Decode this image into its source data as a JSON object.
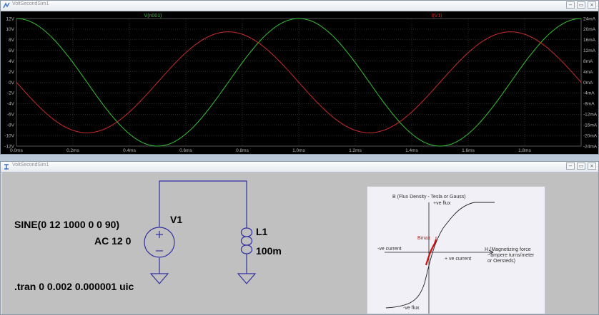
{
  "plot_window": {
    "title": "VoltSecondSim1",
    "trace_voltage_label": "V(n001)",
    "trace_current_label": "I(V1)",
    "trace_voltage_color": "#34c434",
    "trace_current_color": "#c82c2c",
    "left_axis_ticks": [
      "12V",
      "10V",
      "8V",
      "6V",
      "4V",
      "2V",
      "0V",
      "-2V",
      "-4V",
      "-6V",
      "-8V",
      "-10V",
      "-12V"
    ],
    "right_axis_ticks": [
      "24mA",
      "20mA",
      "16mA",
      "12mA",
      "8mA",
      "4mA",
      "0mA",
      "-4mA",
      "-8mA",
      "-12mA",
      "-16mA",
      "-20mA",
      "-24mA"
    ],
    "x_axis_ticks": [
      "0.0ms",
      "0.2ms",
      "0.4ms",
      "0.6ms",
      "0.8ms",
      "1.0ms",
      "1.2ms",
      "1.4ms",
      "1.6ms",
      "1.8ms"
    ]
  },
  "chart_data": {
    "type": "line",
    "x_unit": "ms",
    "xlim": [
      0,
      2.0
    ],
    "ylim_left": [
      -12,
      12
    ],
    "ylim_right": [
      -24,
      24
    ],
    "series": [
      {
        "name": "V(n001)",
        "axis": "left",
        "x": [
          0,
          0.25,
          0.5,
          0.75,
          1.0,
          1.25,
          1.5,
          1.75,
          2.0
        ],
        "values": [
          12,
          0,
          -12,
          0,
          12,
          0,
          -12,
          0,
          12
        ]
      },
      {
        "name": "I(V1)",
        "axis": "right",
        "x": [
          0,
          0.25,
          0.5,
          0.75,
          1.0,
          1.25,
          1.5,
          1.75,
          2.0
        ],
        "values": [
          0,
          -19,
          0,
          19,
          0,
          -19,
          0,
          19,
          0
        ]
      }
    ]
  },
  "schematic_window": {
    "title": "VoltSecondSim1",
    "source_function": "SINE(0 12 1000 0 0 90)",
    "source_name": "V1",
    "source_ac": "AC 12 0",
    "inductor_name": "L1",
    "inductor_value": "100m",
    "directive": ".tran 0 0.002 0.000001 uic",
    "wire_color": "#3030a0"
  },
  "bh_curve": {
    "y_axis_label": "B (Flux Density - Tesla or Gauss)",
    "pos_flux": "+ve flux",
    "neg_flux": "-ve flux",
    "x_axis_label_1": "H (Magnetizing force",
    "x_axis_label_2": "- ampere turns/meter",
    "x_axis_label_3": "or Oersteds)",
    "neg_current": "-ve current",
    "pos_current": "+ ve current",
    "bmax_label": "Bmax",
    "highlight_color": "#cc1111"
  },
  "window_buttons": {
    "minimize": "−",
    "restore": "▭",
    "close": "×"
  }
}
